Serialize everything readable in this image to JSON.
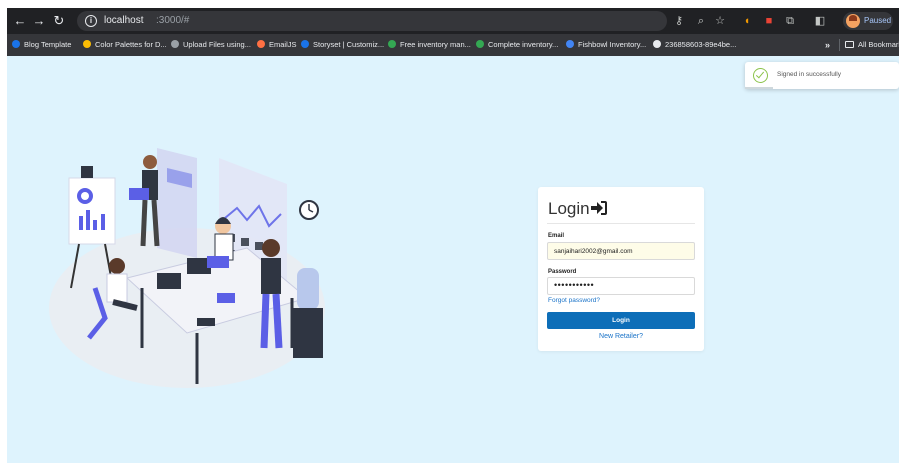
{
  "browser": {
    "url_host": "localhost",
    "url_path": ":3000/#",
    "profile_label": "Paused",
    "bookmarks": [
      {
        "label": "Blog Template",
        "color": "#1a73e8"
      },
      {
        "label": "Color Palettes for D...",
        "color": "#fbbc04"
      },
      {
        "label": "Upload Files using...",
        "color": "#9aa0a6"
      },
      {
        "label": "EmailJS",
        "color": "#ff7043"
      },
      {
        "label": "Storyset | Customiz...",
        "color": "#1a73e8"
      },
      {
        "label": "Free inventory man...",
        "color": "#34a853"
      },
      {
        "label": "Complete inventory...",
        "color": "#34a853"
      },
      {
        "label": "Fishbowl Inventory...",
        "color": "#4285f4"
      },
      {
        "label": "236858603-89e4be...",
        "color": "#e8eaed"
      }
    ],
    "all_bookmarks": "All Bookmarks"
  },
  "toast": {
    "message": "Signed in successfully"
  },
  "login": {
    "title": "Login",
    "email_label": "Email",
    "email_value": "sanjaihari2002@gmail.com",
    "password_label": "Password",
    "password_value": "•••••••••••",
    "forgot_link": "Forgot password?",
    "submit_label": "Login",
    "register_link": "New Retailer?"
  },
  "colors": {
    "page_bg": "#def3fd",
    "accent": "#0d6eb8",
    "illustration_accent": "#5b5fe6"
  }
}
